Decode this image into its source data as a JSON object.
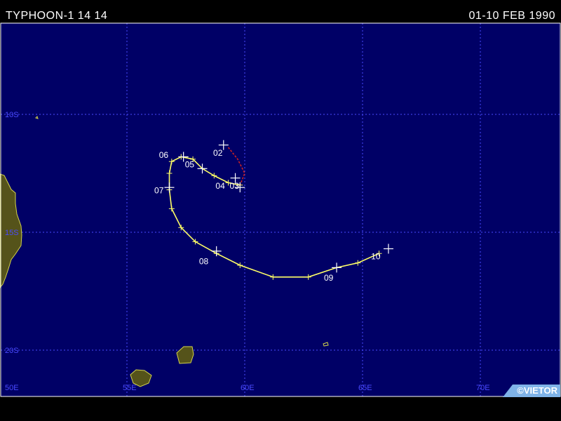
{
  "header": {
    "title": "TYPHOON-1 14 14",
    "dates": "01-10 FEB 1990"
  },
  "map": {
    "lon_range": [
      50,
      74
    ],
    "lat_range": [
      -6,
      -22
    ],
    "lon_labels": [
      "50E",
      "55E",
      "60E",
      "65E",
      "70E"
    ],
    "lat_labels": [
      "10S",
      "15S",
      "20S"
    ],
    "colors": {
      "ocean": "#000066",
      "grid": "#4a4aff",
      "land": "#55531a",
      "coast": "#d4d44a",
      "track": "#ffff66",
      "track_early": "#cc2222",
      "marker": "#ffffff"
    }
  },
  "track": {
    "early_points": [
      [
        59.3,
        -11.4
      ],
      [
        59.7,
        -11.9
      ],
      [
        60.0,
        -12.5
      ],
      [
        59.8,
        -13.0
      ]
    ],
    "points": [
      [
        59.8,
        -13.0
      ],
      [
        59.3,
        -12.9
      ],
      [
        58.7,
        -12.6
      ],
      [
        58.2,
        -12.3
      ],
      [
        57.8,
        -11.9
      ],
      [
        57.3,
        -11.8
      ],
      [
        56.9,
        -12.0
      ],
      [
        56.8,
        -12.5
      ],
      [
        56.8,
        -13.2
      ],
      [
        56.9,
        -14.0
      ],
      [
        57.3,
        -14.8
      ],
      [
        57.9,
        -15.4
      ],
      [
        58.8,
        -15.9
      ],
      [
        59.8,
        -16.4
      ],
      [
        61.2,
        -16.9
      ],
      [
        62.7,
        -16.9
      ],
      [
        63.9,
        -16.5
      ],
      [
        64.8,
        -16.3
      ],
      [
        65.7,
        -15.9
      ]
    ],
    "fix_markers": [
      [
        59.1,
        -11.3
      ],
      [
        59.6,
        -12.7
      ],
      [
        59.8,
        -13.1
      ],
      [
        57.4,
        -11.8
      ],
      [
        58.2,
        -12.3
      ],
      [
        56.8,
        -13.1
      ],
      [
        58.8,
        -15.8
      ],
      [
        63.9,
        -16.5
      ],
      [
        66.1,
        -15.7
      ]
    ],
    "day_labels": [
      {
        "text": "02",
        "lon": 58.9,
        "lat": -11.6
      },
      {
        "text": "03",
        "lon": 59.6,
        "lat": -13.0
      },
      {
        "text": "04",
        "lon": 59.0,
        "lat": -13.0
      },
      {
        "text": "05",
        "lon": 57.7,
        "lat": -12.1
      },
      {
        "text": "06",
        "lon": 56.6,
        "lat": -11.7
      },
      {
        "text": "07",
        "lon": 56.4,
        "lat": -13.2
      },
      {
        "text": "08",
        "lon": 58.3,
        "lat": -16.2
      },
      {
        "text": "09",
        "lon": 63.6,
        "lat": -16.9
      },
      {
        "text": "10",
        "lon": 65.6,
        "lat": -16.0
      }
    ]
  },
  "credit": "©VIETOR"
}
